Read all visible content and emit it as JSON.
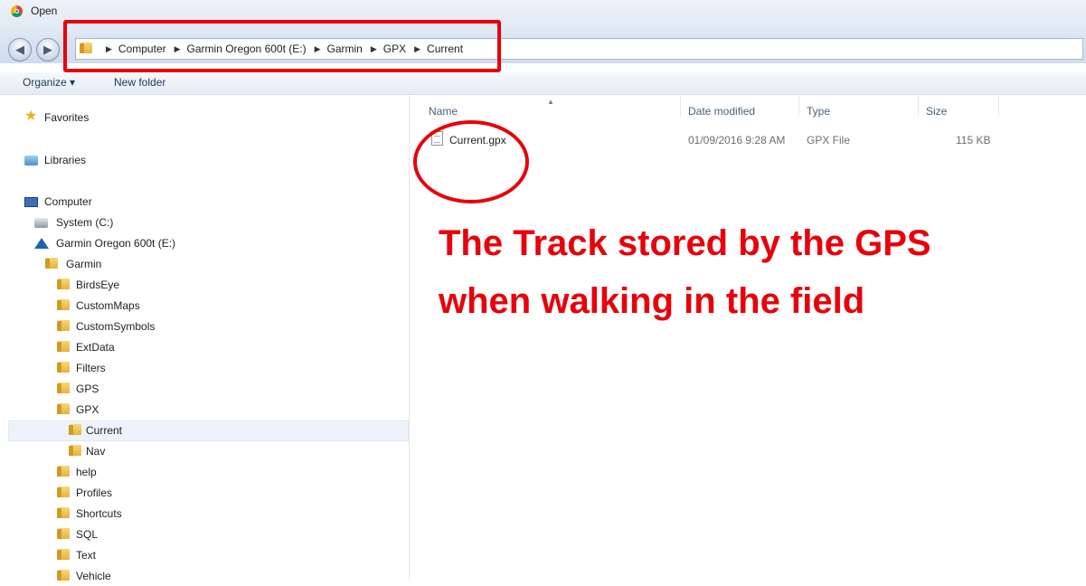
{
  "window": {
    "title": "Open",
    "app_icon": "chrome-icon"
  },
  "nav": {
    "back_icon": "back-arrow-icon",
    "forward_icon": "forward-arrow-icon"
  },
  "breadcrumb": {
    "items": [
      "Computer",
      "Garmin Oregon 600t (E:)",
      "Garmin",
      "GPX",
      "Current"
    ]
  },
  "toolbar": {
    "organize_label": "Organize ▾",
    "new_folder_label": "New folder"
  },
  "sidebar": {
    "favorites": "Favorites",
    "libraries": "Libraries",
    "computer": "Computer",
    "system_drive": "System (C:)",
    "garmin_drive": "Garmin Oregon 600t (E:)",
    "garmin": "Garmin",
    "garmin_folders": [
      "BirdsEye",
      "CustomMaps",
      "CustomSymbols",
      "ExtData",
      "Filters",
      "GPS",
      "GPX"
    ],
    "gpx_folders": [
      "Current",
      "Nav"
    ],
    "more_folders": [
      "help",
      "Profiles",
      "Shortcuts",
      "SQL",
      "Text",
      "Vehicle"
    ],
    "selected": "Current"
  },
  "columns": {
    "name": "Name",
    "date": "Date modified",
    "type": "Type",
    "size": "Size"
  },
  "files": [
    {
      "name": "Current.gpx",
      "date": "01/09/2016 9:28 AM",
      "type": "GPX File",
      "size": "115 KB"
    }
  ],
  "annotation": {
    "line1": "The Track stored by the GPS",
    "line2": "when walking in the field",
    "color": "#e8000b"
  }
}
